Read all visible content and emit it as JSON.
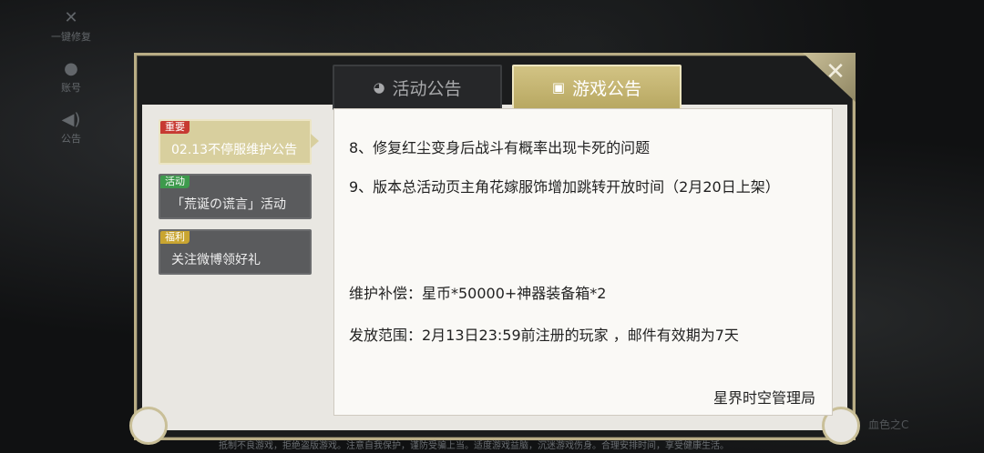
{
  "sidebar": {
    "items": [
      {
        "label": "一键修复",
        "icon": "wrench-hammer-icon"
      },
      {
        "label": "账号",
        "icon": "person-icon"
      },
      {
        "label": "公告",
        "icon": "speaker-icon"
      }
    ]
  },
  "footer": {
    "notice": "抵制不良游戏，拒绝盗版游戏。注意自我保护，谨防受骗上当。适度游戏益脑，沉迷游戏伤身。合理安排时间，享受健康生活。"
  },
  "brand": {
    "text": "血色之C"
  },
  "tabs": [
    {
      "label": "活动公告",
      "icon": "bird-icon",
      "active": false
    },
    {
      "label": "游戏公告",
      "icon": "notice-board-icon",
      "active": true
    }
  ],
  "list": [
    {
      "badge": "重要",
      "title": "02.13不停服维护公告",
      "selected": true
    },
    {
      "badge": "活动",
      "title": "「荒诞の谎言」活动",
      "selected": false
    },
    {
      "badge": "福利",
      "title": "关注微博领好礼",
      "selected": false
    }
  ],
  "content": {
    "line1": "8、修复红尘变身后战斗有概率出现卡死的问题",
    "line2": "9、版本总活动页主角花嫁服饰增加跳转开放时间（2月20日上架）",
    "line3": "维护补偿：星币*50000+神器装备箱*2",
    "line4": "发放范围：2月13日23:59前注册的玩家 ，邮件有效期为7天",
    "signature": "星界时空管理局"
  },
  "colors": {
    "accent_gold": "#c6b873",
    "badge_important": "#c73a32",
    "badge_activity": "#3d9a4c",
    "badge_welfare": "#c9a531"
  }
}
